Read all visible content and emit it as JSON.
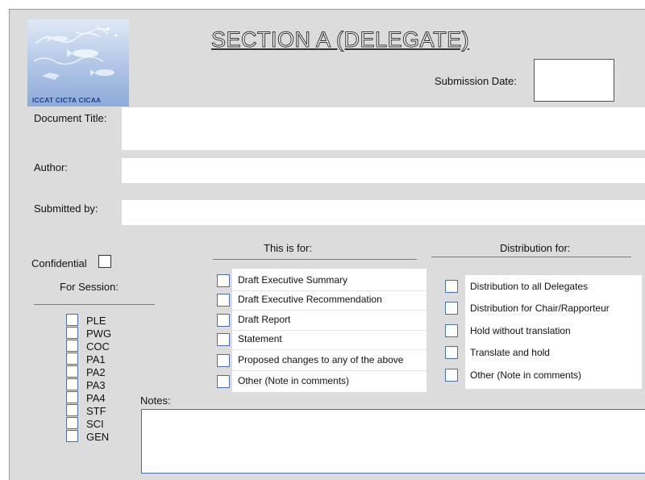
{
  "header": {
    "title": "SECTION A (DELEGATE)",
    "logo_text": "ICCAT CICTA CICAA",
    "submission_date_label": "Submission Date:",
    "submission_date_value": ""
  },
  "fields": {
    "document_title_label": "Document Title:",
    "document_title_value": "",
    "author_label": "Author:",
    "author_value": "",
    "submitted_by_label": "Submitted by:",
    "submitted_by_value": ""
  },
  "confidential_label": "Confidential",
  "session": {
    "label": "For Session:",
    "options": [
      "PLE",
      "PWG",
      "COC",
      "PA1",
      "PA2",
      "PA3",
      "PA4",
      "STF",
      "SCI",
      "GEN"
    ]
  },
  "this_is_for": {
    "header": "This is for:",
    "options": [
      "Draft Executive Summary",
      "Draft Executive Recommendation",
      "Draft Report",
      "Statement",
      "Proposed changes to any of the above",
      "Other (Note in comments)"
    ]
  },
  "distribution": {
    "header": "Distribution for:",
    "options": [
      "Distribution to all Delegates",
      "Distribution for Chair/Rapporteur",
      "Hold without translation",
      "Translate and hold",
      "Other (Note in comments)"
    ]
  },
  "notes": {
    "label": "Notes:",
    "value": ""
  },
  "colors": {
    "background": "#dcdcdc",
    "field": "#ffffff",
    "checkbox_border": "#4a6fa5",
    "logo_text": "#1c3f8f"
  }
}
